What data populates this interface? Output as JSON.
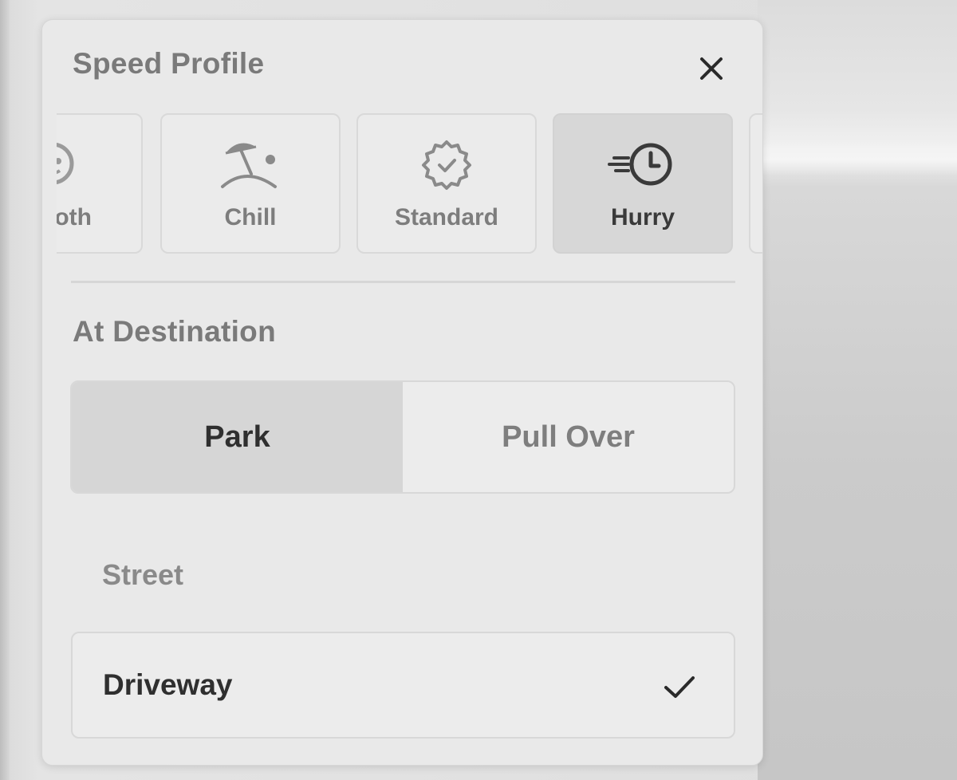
{
  "speed_profile": {
    "title": "Speed Profile",
    "profiles": [
      {
        "label": "Sloth",
        "display_label": "oth",
        "icon": "sloth-icon",
        "selected": false
      },
      {
        "label": "Chill",
        "icon": "beach-umbrella-icon",
        "selected": false
      },
      {
        "label": "Standard",
        "icon": "standard-badge-check-icon",
        "selected": false
      },
      {
        "label": "Hurry",
        "icon": "fast-clock-icon",
        "selected": true
      }
    ]
  },
  "at_destination": {
    "title": "At Destination",
    "segment": [
      {
        "label": "Park",
        "active": true
      },
      {
        "label": "Pull Over",
        "active": false
      }
    ],
    "options": [
      {
        "label": "Street",
        "selected": false
      },
      {
        "label": "Driveway",
        "selected": true
      }
    ]
  },
  "colors": {
    "panel": "#e9e9e9",
    "selected_fill": "#d6d6d6",
    "muted_text": "#7a7a7a",
    "strong_text": "#2f2f2f"
  }
}
